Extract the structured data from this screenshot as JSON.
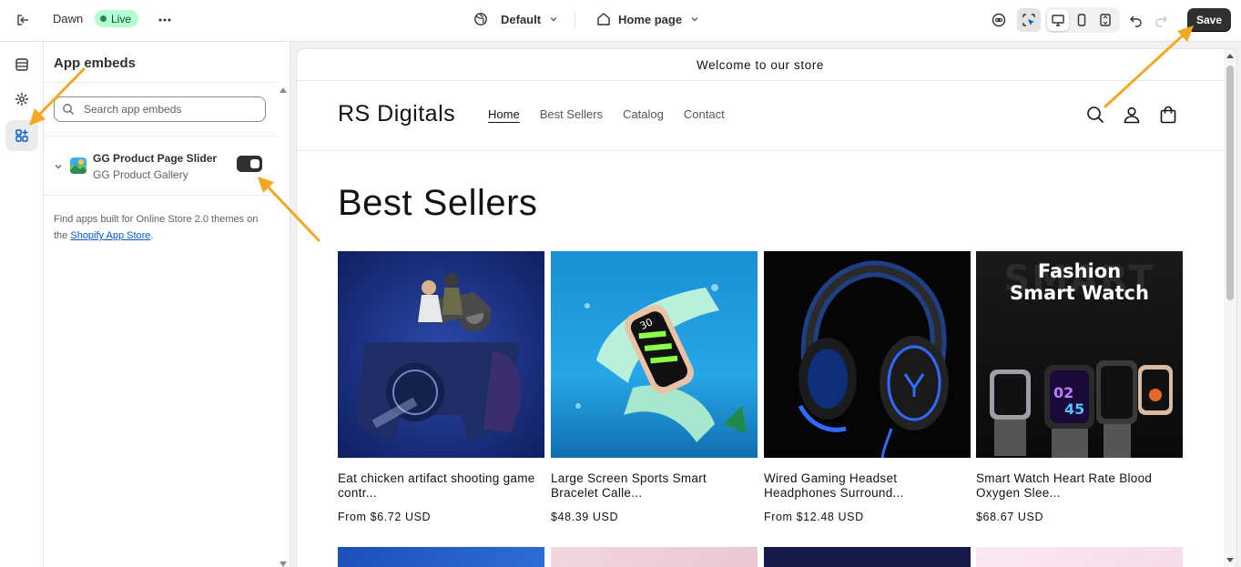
{
  "topbar": {
    "theme_name": "Dawn",
    "status_badge": "Live",
    "preset_label": "Default",
    "page_label": "Home page",
    "save_label": "Save"
  },
  "sidebar": {
    "title": "App embeds",
    "search_placeholder": "Search app embeds",
    "embeds": [
      {
        "name": "GG Product Page Slider",
        "app": "GG Product Gallery",
        "enabled": true
      }
    ],
    "help_prefix": "Find apps built for Online Store 2.0 themes on the ",
    "help_link": "Shopify App Store",
    "help_suffix": "."
  },
  "store": {
    "announcement": "Welcome to our store",
    "logo": "RS Digitals",
    "nav": [
      "Home",
      "Best Sellers",
      "Catalog",
      "Contact"
    ],
    "section_title": "Best Sellers",
    "products": [
      {
        "name": "Eat chicken artifact shooting game contr...",
        "price": "From $6.72 USD",
        "image": "gamepad-controller"
      },
      {
        "name": "Large Screen Sports Smart Bracelet Calle...",
        "price": "$48.39 USD",
        "image": "smart-bracelet"
      },
      {
        "name": "Wired Gaming Headset Headphones Surround...",
        "price": "From $12.48 USD",
        "image": "gaming-headset"
      },
      {
        "name": "Smart Watch Heart Rate Blood Oxygen Slee...",
        "price": "$68.67 USD",
        "image": "smart-watches",
        "overlay_line1": "Fashion",
        "overlay_line2": "Smart Watch",
        "overlay_bg": "SMART"
      }
    ]
  },
  "colors": {
    "accent_arrow": "#f5a623",
    "primary_button": "#303030",
    "live_badge": "#b4fed2",
    "link": "#005bd3"
  }
}
